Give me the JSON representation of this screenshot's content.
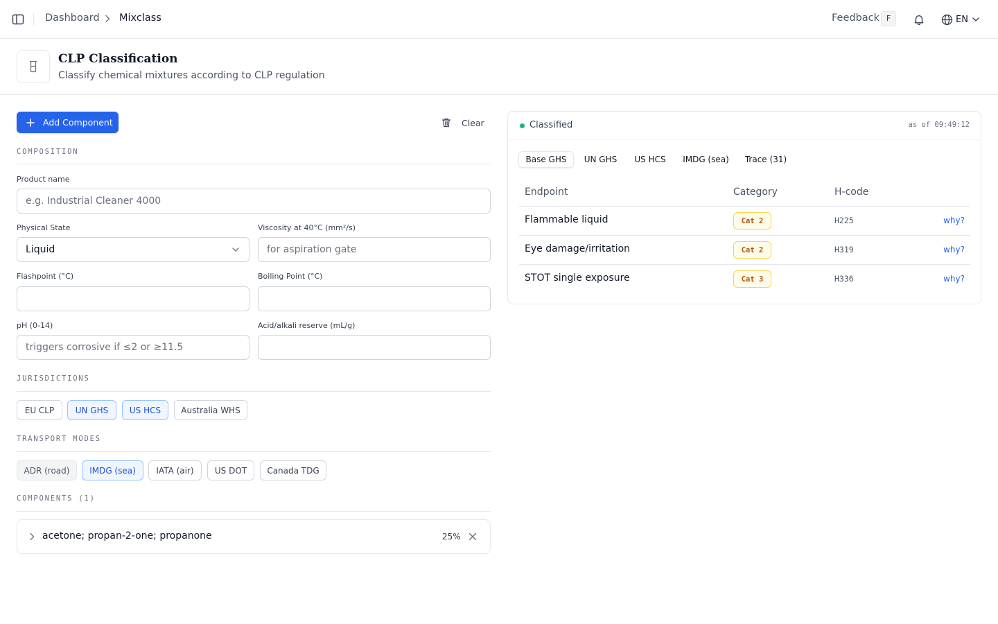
{
  "topbar": {
    "breadcrumb": [
      "Dashboard",
      "Mixclass"
    ],
    "feedback_label": "Feedback",
    "feedback_shortcut": "F",
    "language": "EN"
  },
  "header": {
    "title": "CLP Classification",
    "subtitle": "Classify chemical mixtures according to CLP regulation"
  },
  "actions": {
    "add_component": "Add Component",
    "clear": "Clear"
  },
  "composition": {
    "section_label": "COMPOSITION",
    "product_name": {
      "label": "Product name",
      "value": "",
      "placeholder": "e.g. Industrial Cleaner 4000"
    },
    "physical_state": {
      "label": "Physical State",
      "value": "Liquid"
    },
    "viscosity": {
      "label": "Viscosity at 40°C (mm²/s)",
      "value": "",
      "placeholder": "for aspiration gate"
    },
    "flashpoint": {
      "label": "Flashpoint (°C)",
      "value": "",
      "placeholder": ""
    },
    "boiling_point": {
      "label": "Boiling Point (°C)",
      "value": "",
      "placeholder": ""
    },
    "ph": {
      "label": "pH (0-14)",
      "value": "",
      "placeholder": "triggers corrosive if ≤2 or ≥11.5"
    },
    "reserve": {
      "label": "Acid/alkali reserve (mL/g)",
      "value": "",
      "placeholder": ""
    }
  },
  "jurisdictions": {
    "section_label": "JURISDICTIONS",
    "options": [
      {
        "label": "EU CLP",
        "state": "unselected"
      },
      {
        "label": "UN GHS",
        "state": "selected"
      },
      {
        "label": "US HCS",
        "state": "selected"
      },
      {
        "label": "Australia WHS",
        "state": "unselected"
      }
    ]
  },
  "transport": {
    "section_label": "TRANSPORT MODES",
    "options": [
      {
        "label": "ADR (road)",
        "state": "disabled"
      },
      {
        "label": "IMDG (sea)",
        "state": "selected"
      },
      {
        "label": "IATA (air)",
        "state": "unselected"
      },
      {
        "label": "US DOT",
        "state": "unselected"
      },
      {
        "label": "Canada TDG",
        "state": "unselected"
      }
    ]
  },
  "components": {
    "section_label": "COMPONENTS (1)",
    "items": [
      {
        "name": "acetone; propan-2-one; propanone",
        "percent": "25%"
      }
    ]
  },
  "results": {
    "status": "Classified",
    "status_color": "#10b981",
    "as_of": "as of 09:49:12",
    "tabs": [
      "Base GHS",
      "UN GHS",
      "US HCS",
      "IMDG (sea)",
      "Trace (31)"
    ],
    "active_tab": "Base GHS",
    "columns": [
      "Endpoint",
      "Category",
      "H-code"
    ],
    "rows": [
      {
        "endpoint": "Flammable liquid",
        "category": "Cat 2",
        "hcode": "H225",
        "link": "why?"
      },
      {
        "endpoint": "Eye damage/irritation",
        "category": "Cat 2",
        "hcode": "H319",
        "link": "why?"
      },
      {
        "endpoint": "STOT single exposure",
        "category": "Cat 3",
        "hcode": "H336",
        "link": "why?"
      }
    ]
  },
  "colors": {
    "primary": "#2563eb",
    "selected_chip_bg": "#eff6ff",
    "badge_bg": "#fefce8",
    "badge_text": "#b45309"
  },
  "icons": [
    "sidebar-toggle-icon",
    "chevron-right-icon",
    "bell-icon",
    "globe-icon",
    "chevron-down-icon",
    "beaker-icon",
    "plus-icon",
    "trash-icon",
    "close-icon"
  ]
}
